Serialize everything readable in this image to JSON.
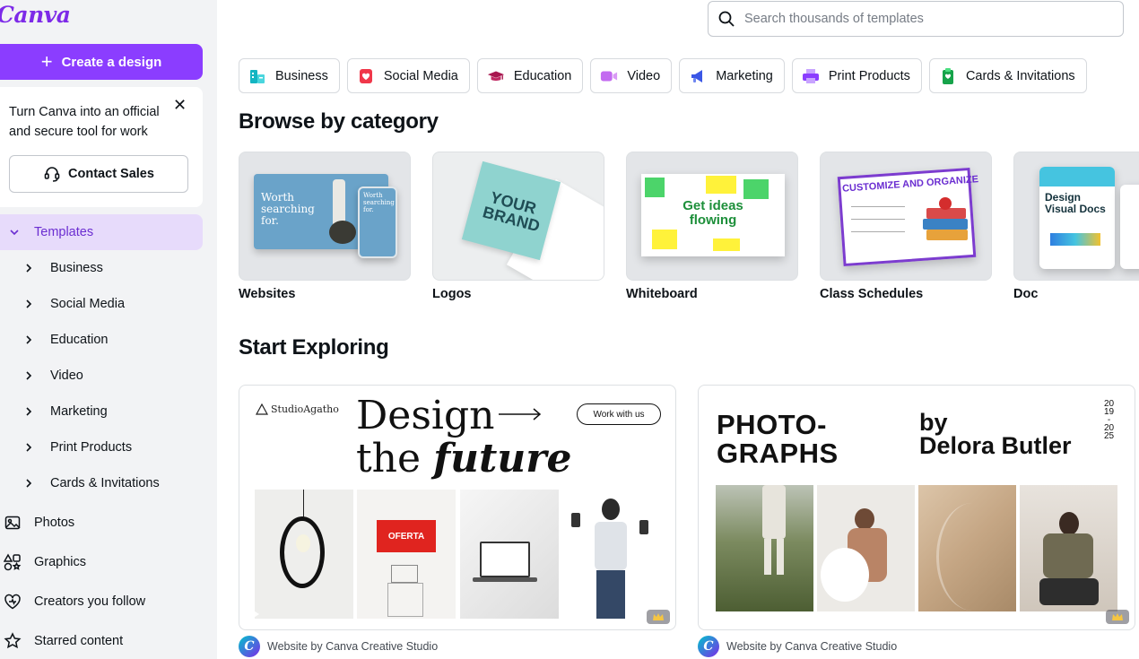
{
  "logo": "Canva",
  "sidebar": {
    "create_label": "Create a design",
    "promo_text": "Turn Canva into an official and secure tool for work",
    "contact_label": "Contact Sales",
    "templates_label": "Templates",
    "template_items": [
      {
        "label": "Business"
      },
      {
        "label": "Social Media"
      },
      {
        "label": "Education"
      },
      {
        "label": "Video"
      },
      {
        "label": "Marketing"
      },
      {
        "label": "Print Products"
      },
      {
        "label": "Cards & Invitations"
      }
    ],
    "main_items": [
      {
        "label": "Photos",
        "icon": "image-icon"
      },
      {
        "label": "Graphics",
        "icon": "shapes-icon"
      },
      {
        "label": "Creators you follow",
        "icon": "heart-icon"
      },
      {
        "label": "Starred content",
        "icon": "star-icon"
      }
    ]
  },
  "search": {
    "placeholder": "Search thousands of templates"
  },
  "chips": [
    {
      "label": "Business",
      "icon": "building-icon",
      "color": "#13b5c2"
    },
    {
      "label": "Social Media",
      "icon": "heart-icon",
      "color": "#f0374a"
    },
    {
      "label": "Education",
      "icon": "graduation-cap-icon",
      "color": "#a8174f"
    },
    {
      "label": "Video",
      "icon": "video-icon",
      "color": "#c36bf0"
    },
    {
      "label": "Marketing",
      "icon": "megaphone-icon",
      "color": "#3b57e6"
    },
    {
      "label": "Print Products",
      "icon": "printer-icon",
      "color": "#8b3dff"
    },
    {
      "label": "Cards & Invitations",
      "icon": "card-icon",
      "color": "#16a34a"
    }
  ],
  "browse": {
    "title": "Browse by category",
    "categories": [
      {
        "label": "Websites",
        "thumb_text": "Worth searching for."
      },
      {
        "label": "Logos",
        "thumb_text": "YOUR BRAND"
      },
      {
        "label": "Whiteboard",
        "thumb_text": "Get ideas flowing"
      },
      {
        "label": "Class Schedules",
        "thumb_text": "CUSTOMIZE AND ORGANIZE"
      },
      {
        "label": "Doc",
        "thumb_text": "Design Visual Docs"
      }
    ]
  },
  "explore": {
    "title": "Start Exploring",
    "tiles": [
      {
        "brand": "StudioAgatho",
        "headline_1": "Design",
        "headline_2a": "the",
        "headline_2b": "future",
        "cta": "Work with us",
        "sign_text": "OFERTA",
        "caption": "Website by Canva Creative Studio"
      },
      {
        "headline_1": "PHOTO-",
        "headline_2": "GRAPHS",
        "by_1": "by",
        "by_2": "Delora Butler",
        "years": [
          "20",
          "19",
          "-",
          "20",
          "25"
        ],
        "caption": "Website by Canva Creative Studio"
      }
    ]
  }
}
